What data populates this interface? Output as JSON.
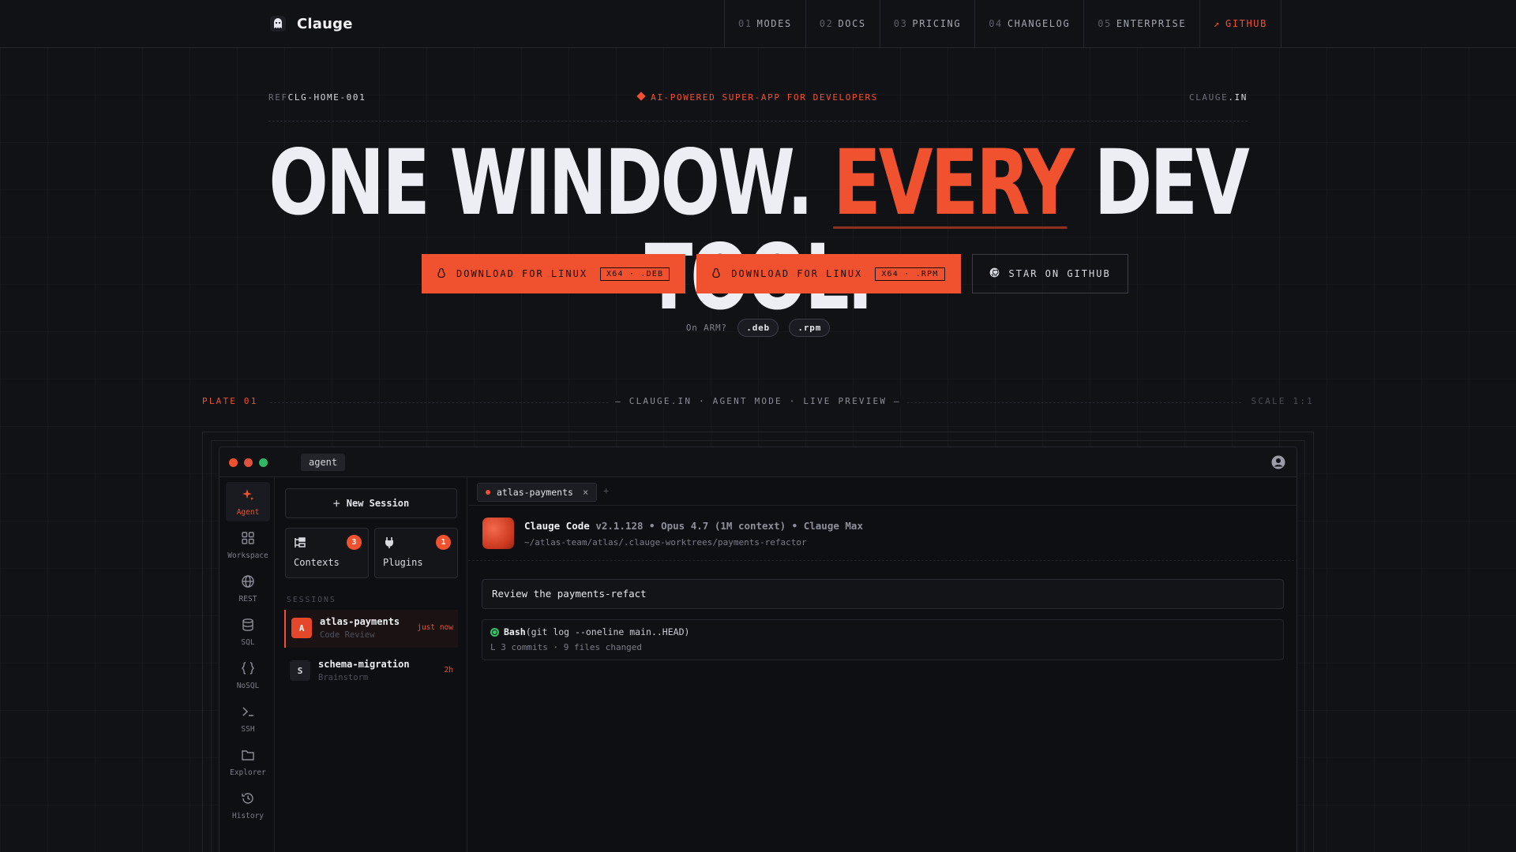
{
  "brand": {
    "name": "Clauge"
  },
  "nav": {
    "links": [
      {
        "num": "01",
        "label": "MODES"
      },
      {
        "num": "02",
        "label": "DOCS"
      },
      {
        "num": "03",
        "label": "PRICING"
      },
      {
        "num": "04",
        "label": "CHANGELOG"
      },
      {
        "num": "05",
        "label": "ENTERPRISE"
      },
      {
        "num": "↗",
        "label": "GITHUB"
      }
    ]
  },
  "ref": {
    "prefix": "REF",
    "code": "CLG-HOME-001",
    "tagline": "AI-POWERED SUPER-APP FOR DEVELOPERS",
    "domain_a": "CLAUGE",
    "domain_b": ".IN"
  },
  "headline": {
    "part1": "ONE WINDOW. ",
    "highlight": "EVERY",
    "part2": " DEV TOOL."
  },
  "cta": {
    "deb": {
      "label": "DOWNLOAD FOR LINUX",
      "tag": "X64 · .DEB"
    },
    "rpm": {
      "label": "DOWNLOAD FOR LINUX",
      "tag": "X64 · .RPM"
    },
    "github": {
      "label": "STAR ON GITHUB"
    }
  },
  "arm": {
    "label": "On ARM?",
    "deb": ".deb",
    "rpm": ".rpm"
  },
  "plate": {
    "left": "PLATE 01",
    "mid": "— CLAUGE.IN · AGENT MODE · LIVE PREVIEW —",
    "right": "SCALE 1:1"
  },
  "app": {
    "title_tag": "agent",
    "rail": [
      {
        "label": "Agent",
        "icon": "sparkle-icon"
      },
      {
        "label": "Workspace",
        "icon": "grid-icon"
      },
      {
        "label": "REST",
        "icon": "globe-icon"
      },
      {
        "label": "SQL",
        "icon": "database-icon"
      },
      {
        "label": "NoSQL",
        "icon": "braces-icon"
      },
      {
        "label": "SSH",
        "icon": "terminal-icon"
      },
      {
        "label": "Explorer",
        "icon": "folder-icon"
      },
      {
        "label": "History",
        "icon": "history-icon"
      }
    ],
    "new_session": "New Session",
    "cards": [
      {
        "label": "Contexts",
        "badge": "3"
      },
      {
        "label": "Plugins",
        "badge": "1"
      }
    ],
    "sessions_label": "SESSIONS",
    "sessions": [
      {
        "initial": "A",
        "name": "atlas-payments",
        "sub": "Code Review",
        "time": "just now"
      },
      {
        "initial": "S",
        "name": "schema-migration",
        "sub": "Brainstorm",
        "time": "2h"
      }
    ],
    "tab": {
      "label": "atlas-payments",
      "close": "×",
      "plus": "+"
    },
    "info": {
      "product": "Clauge Code",
      "meta": " v2.1.128 • Opus 4.7 (1M context) • Clauge Max",
      "path": "~/atlas-team/atlas/.clauge-worktrees/payments-refactor"
    },
    "prompt": "Review the payments-refact",
    "tool": {
      "name": "Bash",
      "args": "(git log --oneline main..HEAD)",
      "result": "L 3 commits · 9 files changed"
    }
  },
  "colors": {
    "accent": "#f0522f",
    "bg": "#111216",
    "success": "#35c46a"
  }
}
